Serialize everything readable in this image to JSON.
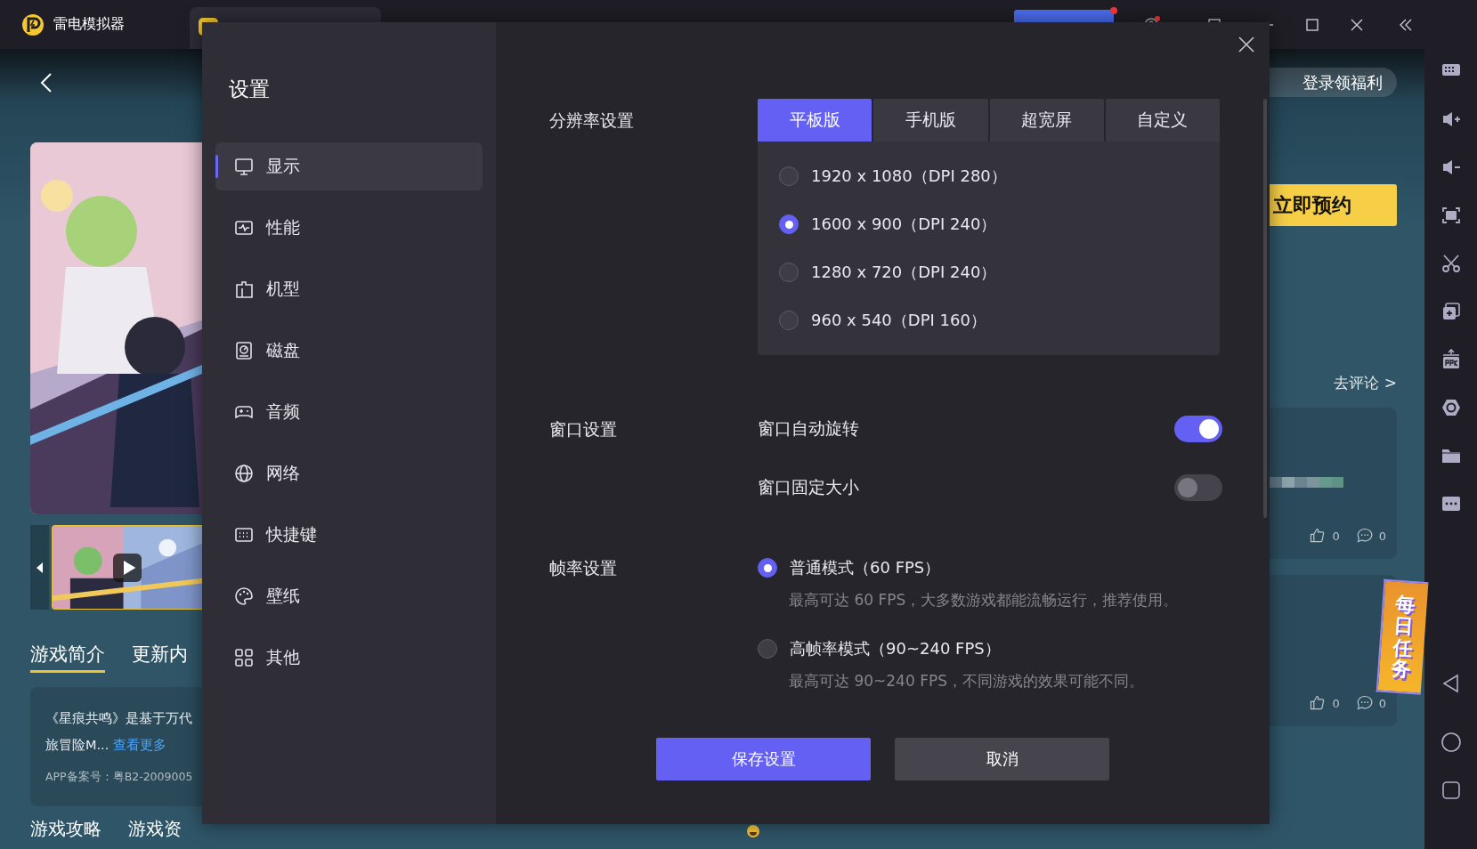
{
  "app": {
    "title": "雷电模拟器"
  },
  "game_page": {
    "intro_tabs": [
      {
        "label": "游戏简介",
        "selected": true
      },
      {
        "label": "更新内",
        "selected": false
      }
    ],
    "description": [
      "《星痕共鸣》是基于万代",
      "旅冒险M..."
    ],
    "more_link": "查看更多",
    "filing": "APP备案号：粤B2-2009005",
    "section_tabs": [
      "游戏攻略",
      "游戏资"
    ],
    "login_button": "登录领福利",
    "reserve_button": "立即预约",
    "review_link": "去评论 >",
    "reviews": [
      {
        "likes": "0",
        "comments": "0"
      },
      {
        "likes": "0",
        "comments": "0"
      }
    ],
    "daily_task": "每日任务"
  },
  "settings": {
    "title": "设置",
    "nav": [
      {
        "label": "显示",
        "selected": true
      },
      {
        "label": "性能",
        "selected": false
      },
      {
        "label": "机型",
        "selected": false
      },
      {
        "label": "磁盘",
        "selected": false
      },
      {
        "label": "音频",
        "selected": false
      },
      {
        "label": "网络",
        "selected": false
      },
      {
        "label": "快捷键",
        "selected": false
      },
      {
        "label": "壁纸",
        "selected": false
      },
      {
        "label": "其他",
        "selected": false
      }
    ],
    "resolution": {
      "label": "分辨率设置",
      "tabs": [
        {
          "label": "平板版",
          "selected": true
        },
        {
          "label": "手机版",
          "selected": false
        },
        {
          "label": "超宽屏",
          "selected": false
        },
        {
          "label": "自定义",
          "selected": false
        }
      ],
      "options": [
        {
          "label": "1920 x 1080（DPI 280）",
          "selected": false
        },
        {
          "label": "1600 x 900（DPI 240）",
          "selected": true
        },
        {
          "label": "1280 x 720（DPI 240）",
          "selected": false
        },
        {
          "label": "960 x 540（DPI 160）",
          "selected": false
        }
      ]
    },
    "window": {
      "label": "窗口设置",
      "toggles": [
        {
          "label": "窗口自动旋转",
          "on": true
        },
        {
          "label": "窗口固定大小",
          "on": false
        }
      ]
    },
    "frame_rate": {
      "label": "帧率设置",
      "options": [
        {
          "label": "普通模式（60 FPS）",
          "description": "最高可达 60 FPS，大多数游戏都能流畅运行，推荐使用。",
          "selected": true
        },
        {
          "label": "高帧率模式（90~240 FPS）",
          "description": "最高可达 90~240 FPS，不同游戏的效果可能不同。",
          "selected": false
        }
      ]
    },
    "buttons": {
      "save": "保存设置",
      "cancel": "取消"
    }
  }
}
